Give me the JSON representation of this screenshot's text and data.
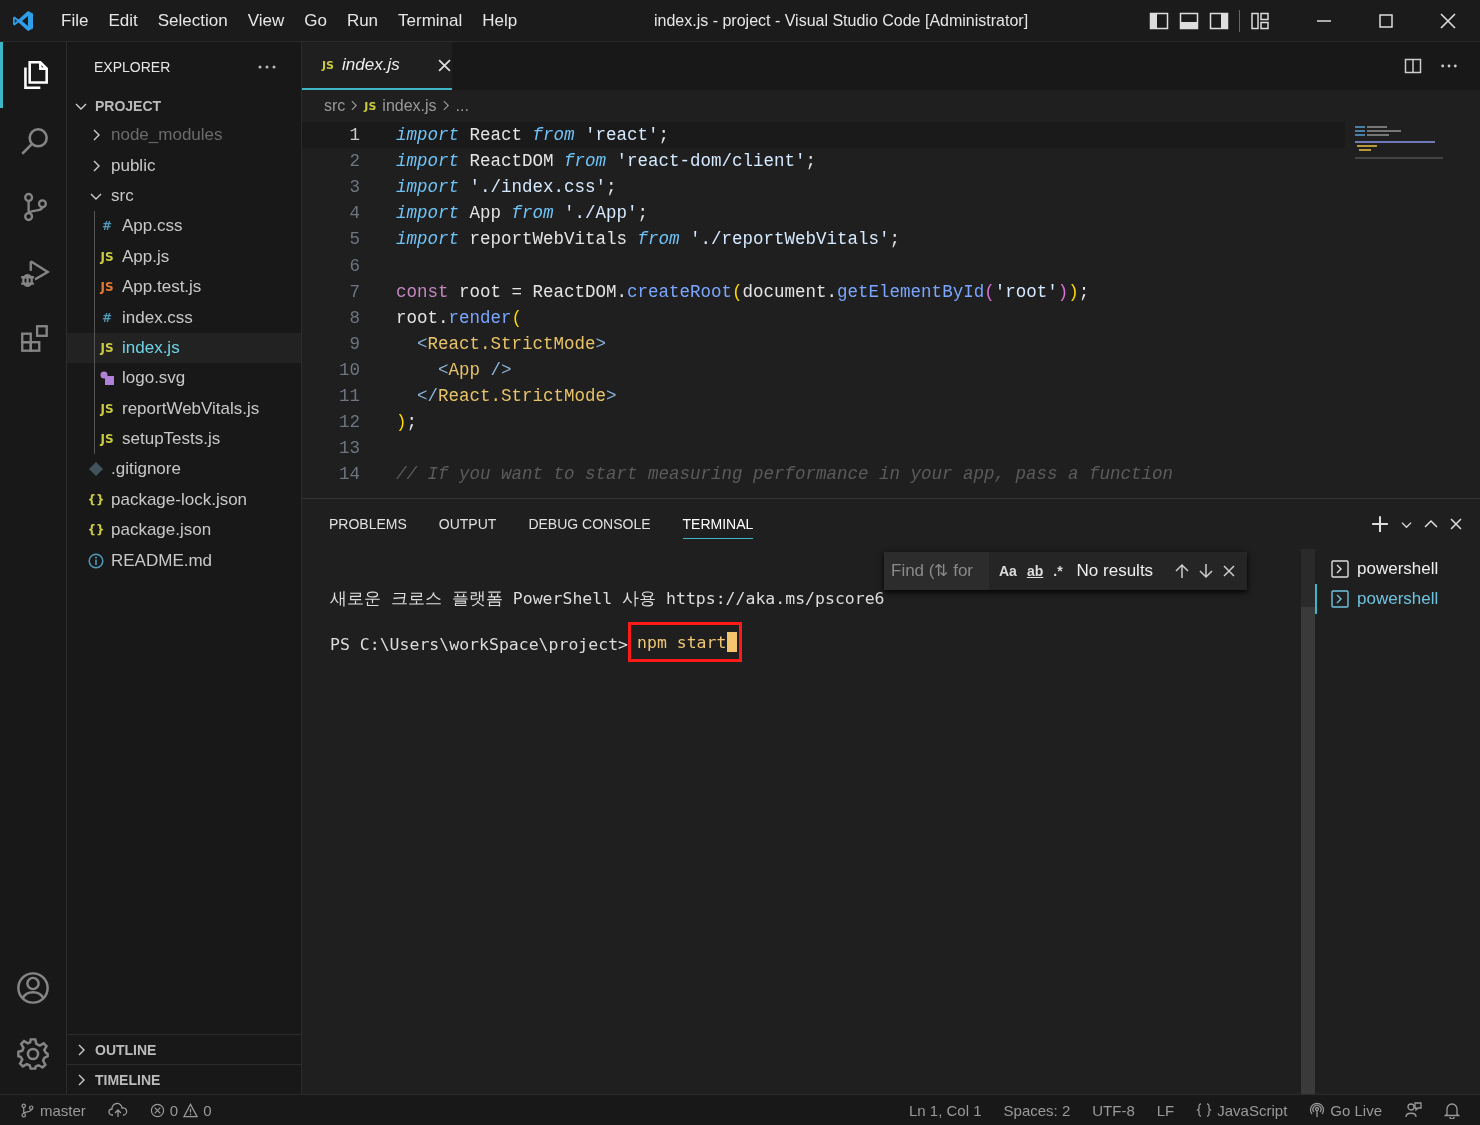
{
  "title_bar": {
    "menus": [
      "File",
      "Edit",
      "Selection",
      "View",
      "Go",
      "Run",
      "Terminal",
      "Help"
    ],
    "title": "index.js - project - Visual Studio Code [Administrator]"
  },
  "activity_bar": {
    "items": [
      {
        "kind": "explorer",
        "selected": true
      },
      {
        "kind": "search",
        "selected": false
      },
      {
        "kind": "source-control",
        "selected": false
      },
      {
        "kind": "run-debug",
        "selected": false
      },
      {
        "kind": "extensions",
        "selected": false
      }
    ]
  },
  "sidebar": {
    "title": "EXPLORER",
    "project": {
      "title": "PROJECT",
      "expanded": true,
      "children": [
        {
          "name": "node_modules",
          "kind": "folder",
          "expanded": false,
          "dimmed": true,
          "selected": false
        },
        {
          "name": "public",
          "kind": "folder",
          "expanded": false,
          "dimmed": false,
          "selected": false
        },
        {
          "name": "src",
          "kind": "folder",
          "expanded": true,
          "dimmed": false,
          "selected": false,
          "children": [
            {
              "name": "App.css",
              "kind": "file",
              "icon": "#",
              "color": "#519aba",
              "dimmed": false,
              "selected": false
            },
            {
              "name": "App.js",
              "kind": "file",
              "icon": "JS",
              "color": "#cbcb41",
              "dimmed": false,
              "selected": false
            },
            {
              "name": "App.test.js",
              "kind": "file",
              "icon": "JS",
              "color": "#e37933",
              "dimmed": false,
              "selected": false
            },
            {
              "name": "index.css",
              "kind": "file",
              "icon": "#",
              "color": "#519aba",
              "dimmed": false,
              "selected": false
            },
            {
              "name": "index.js",
              "kind": "file",
              "icon": "JS",
              "color": "#cbcb41",
              "dimmed": false,
              "selected": true
            },
            {
              "name": "logo.svg",
              "kind": "image",
              "dimmed": false,
              "selected": false
            },
            {
              "name": "reportWebVitals.js",
              "kind": "file",
              "icon": "JS",
              "color": "#cbcb41",
              "dimmed": false,
              "selected": false
            },
            {
              "name": "setupTests.js",
              "kind": "file",
              "icon": "JS",
              "color": "#cbcb41",
              "dimmed": false,
              "selected": false
            }
          ]
        },
        {
          "name": ".gitignore",
          "kind": "git",
          "dimmed": false,
          "selected": false
        },
        {
          "name": "package-lock.json",
          "kind": "file",
          "icon": "{}",
          "color": "#cbcb41",
          "dimmed": false,
          "selected": false
        },
        {
          "name": "package.json",
          "kind": "file",
          "icon": "{}",
          "color": "#cbcb41",
          "dimmed": false,
          "selected": false
        },
        {
          "name": "README.md",
          "kind": "info",
          "dimmed": false,
          "selected": false
        }
      ]
    },
    "bottom_sections": [
      {
        "title": "OUTLINE",
        "expanded": false
      },
      {
        "title": "TIMELINE",
        "expanded": false
      }
    ]
  },
  "editor": {
    "tab": {
      "icon": "JS",
      "label": "index.js",
      "preview": true
    },
    "breadcrumb": [
      {
        "text": "src"
      },
      {
        "icon": "JS",
        "text": "index.js"
      },
      {
        "text": "..."
      }
    ],
    "lines": [
      {
        "number": "1",
        "current": true,
        "tokens": [
          {
            "kind": "kw",
            "text": "import"
          },
          {
            "kind": "id",
            "text": " React "
          },
          {
            "kind": "kw",
            "text": "from"
          },
          {
            "kind": "str",
            "text": " 'react'"
          },
          {
            "kind": "id",
            "text": ";"
          }
        ]
      },
      {
        "number": "2",
        "current": false,
        "tokens": [
          {
            "kind": "kw",
            "text": "import"
          },
          {
            "kind": "id",
            "text": " ReactDOM "
          },
          {
            "kind": "kw",
            "text": "from"
          },
          {
            "kind": "str",
            "text": " 'react-dom/client'"
          },
          {
            "kind": "id",
            "text": ";"
          }
        ]
      },
      {
        "number": "3",
        "current": false,
        "tokens": [
          {
            "kind": "kw",
            "text": "import"
          },
          {
            "kind": "str",
            "text": " './index.css'"
          },
          {
            "kind": "id",
            "text": ";"
          }
        ]
      },
      {
        "number": "4",
        "current": false,
        "tokens": [
          {
            "kind": "kw",
            "text": "import"
          },
          {
            "kind": "id",
            "text": " App "
          },
          {
            "kind": "kw",
            "text": "from"
          },
          {
            "kind": "str",
            "text": " './App'"
          },
          {
            "kind": "id",
            "text": ";"
          }
        ]
      },
      {
        "number": "5",
        "current": false,
        "tokens": [
          {
            "kind": "kw",
            "text": "import"
          },
          {
            "kind": "id",
            "text": " reportWebVitals "
          },
          {
            "kind": "kw",
            "text": "from"
          },
          {
            "kind": "str",
            "text": " './reportWebVitals'"
          },
          {
            "kind": "id",
            "text": ";"
          }
        ]
      },
      {
        "number": "6",
        "current": false
      },
      {
        "number": "7",
        "current": false,
        "tokens": [
          {
            "kind": "const",
            "text": "const"
          },
          {
            "kind": "id",
            "text": " root = ReactDOM."
          },
          {
            "kind": "method",
            "text": "createRoot"
          },
          {
            "kind": "p1",
            "text": "("
          },
          {
            "kind": "id",
            "text": "document."
          },
          {
            "kind": "method",
            "text": "getElementById"
          },
          {
            "kind": "p2",
            "text": "("
          },
          {
            "kind": "str",
            "text": "'root'"
          },
          {
            "kind": "p2",
            "text": ")"
          },
          {
            "kind": "p1",
            "text": ")"
          },
          {
            "kind": "id",
            "text": ";"
          }
        ]
      },
      {
        "number": "8",
        "current": false,
        "tokens": [
          {
            "kind": "id",
            "text": "root."
          },
          {
            "kind": "method",
            "text": "render"
          },
          {
            "kind": "p1",
            "text": "("
          }
        ]
      },
      {
        "number": "9",
        "current": false,
        "tokens": [
          {
            "kind": "angle",
            "text": "  <"
          },
          {
            "kind": "tag",
            "text": "React.StrictMode"
          },
          {
            "kind": "angle",
            "text": ">"
          }
        ]
      },
      {
        "number": "10",
        "current": false,
        "tokens": [
          {
            "kind": "angle",
            "text": "    <"
          },
          {
            "kind": "tag",
            "text": "App"
          },
          {
            "kind": "angle",
            "text": " />"
          }
        ]
      },
      {
        "number": "11",
        "current": false,
        "tokens": [
          {
            "kind": "angle",
            "text": "  </"
          },
          {
            "kind": "tag",
            "text": "React.StrictMode"
          },
          {
            "kind": "angle",
            "text": ">"
          }
        ]
      },
      {
        "number": "12",
        "current": false,
        "tokens": [
          {
            "kind": "p1",
            "text": ")"
          },
          {
            "kind": "id",
            "text": ";"
          }
        ]
      },
      {
        "number": "13",
        "current": false
      },
      {
        "number": "14",
        "current": false,
        "tokens": [
          {
            "kind": "comment",
            "text": "// If you want to start measuring performance in your app, pass a function"
          }
        ]
      }
    ]
  },
  "panel": {
    "tabs": [
      {
        "label": "PROBLEMS",
        "selected": false
      },
      {
        "label": "OUTPUT",
        "selected": false
      },
      {
        "label": "DEBUG CONSOLE",
        "selected": false
      },
      {
        "label": "TERMINAL",
        "selected": true
      }
    ],
    "find": {
      "placeholder": "Find (⇅ for",
      "toggles": [
        {
          "kind": "case",
          "text": "Aa"
        },
        {
          "kind": "word",
          "text": "ab"
        },
        {
          "kind": "regex",
          "text": ".*"
        }
      ],
      "result": "No results"
    },
    "terminal": [
      {
        "kind": "text",
        "text": "새로운 크로스 플랫폼 PowerShell 사용 https://aka.ms/pscore6"
      },
      {
        "kind": "prompt",
        "prompt": "PS C:\\Users\\workSpace\\project>",
        "command": "npm start",
        "highlighted": true
      }
    ],
    "sessions": [
      {
        "label": "powershell",
        "selected": false
      },
      {
        "label": "powershell",
        "selected": true
      }
    ]
  },
  "status_bar": {
    "left": [
      {
        "kind": "branch",
        "text": "master"
      },
      {
        "kind": "sync"
      },
      {
        "kind": "problems",
        "errors": "0",
        "warnings": "0"
      }
    ],
    "right": [
      {
        "kind": "text",
        "text": "Ln 1, Col 1"
      },
      {
        "kind": "text",
        "text": "Spaces: 2"
      },
      {
        "kind": "text",
        "text": "UTF-8"
      },
      {
        "kind": "text",
        "text": "LF"
      },
      {
        "kind": "language",
        "text": "JavaScript"
      },
      {
        "kind": "golive",
        "text": "Go Live"
      },
      {
        "kind": "feedback"
      },
      {
        "kind": "bell"
      }
    ]
  }
}
